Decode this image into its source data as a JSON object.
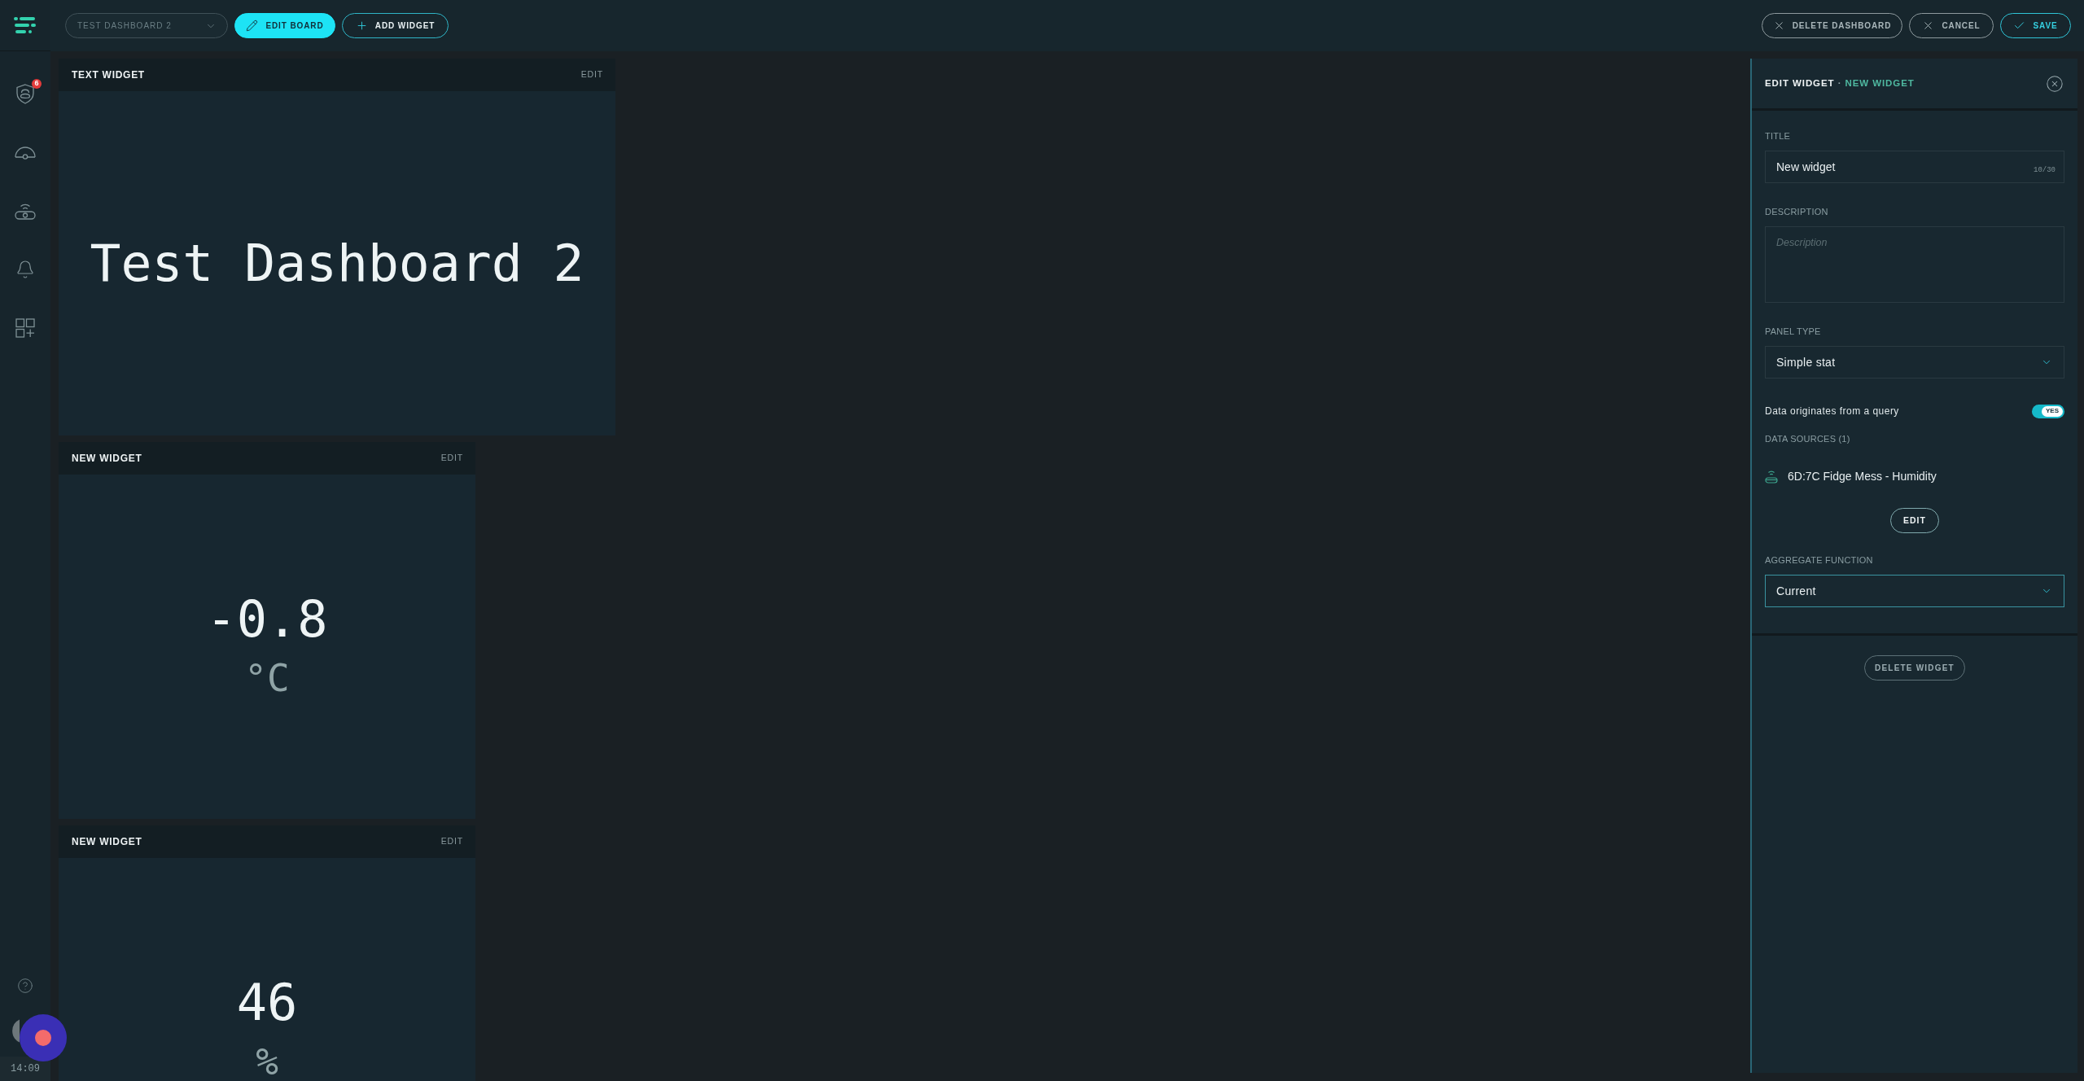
{
  "sidebar": {
    "alert_badge": "6",
    "clock": "14:09"
  },
  "toolbar": {
    "dashboard_select": {
      "value": "TEST DASHBOARD 2",
      "disabled": true
    },
    "left_buttons": [
      {
        "kind": "edit",
        "label": "EDIT BOARD"
      },
      {
        "kind": "add",
        "label": "ADD WIDGET"
      }
    ],
    "right_buttons": [
      {
        "kind": "delete",
        "label": "DELETE DASHBOARD"
      },
      {
        "kind": "cancel",
        "label": "CANCEL"
      },
      {
        "kind": "save",
        "label": "SAVE"
      }
    ]
  },
  "widgets": [
    {
      "kind": "text",
      "title": "TEXT WIDGET",
      "edit": "EDIT",
      "text": "Test Dashboard 2"
    },
    {
      "kind": "stat",
      "title": "NEW WIDGET",
      "edit": "EDIT",
      "value": "-0.8",
      "unit": "°C"
    },
    {
      "kind": "stat",
      "title": "NEW WIDGET",
      "edit": "EDIT",
      "value": "46",
      "unit": "%"
    }
  ],
  "editor": {
    "title": "EDIT WIDGET",
    "separator": "·",
    "subtitle": "NEW WIDGET",
    "fields": [
      {
        "kind": "text",
        "label": "TITLE",
        "value": "New widget",
        "counter": "10/30"
      },
      {
        "kind": "textarea",
        "label": "DESCRIPTION",
        "placeholder": "Description"
      },
      {
        "kind": "select",
        "label": "PANEL TYPE",
        "value": "Simple stat",
        "focused": false
      }
    ],
    "query_toggle": {
      "label": "Data originates from a query",
      "on": true,
      "text": "YES"
    },
    "data_sources": {
      "label": "DATA SOURCES (1)",
      "items": [
        {
          "name": "6D:7C Fidge Mess - Humidity"
        }
      ],
      "edit_button": "EDIT"
    },
    "aggregate": {
      "label": "AGGREGATE FUNCTION",
      "value": "Current",
      "focused": true
    },
    "delete_button": "DELETE WIDGET"
  }
}
